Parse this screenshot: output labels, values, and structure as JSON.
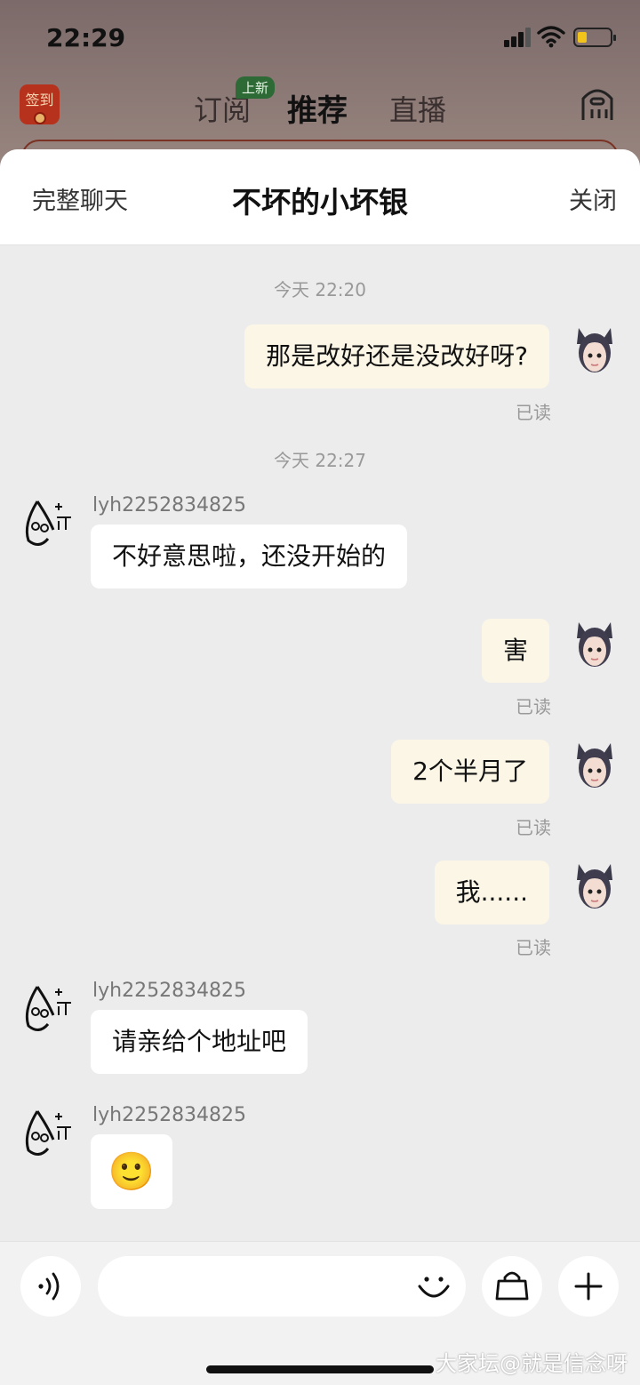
{
  "status_bar": {
    "time": "22:29",
    "battery_level": 0.3
  },
  "background_app": {
    "checkin_label": "签到",
    "tabs": [
      {
        "label": "订阅"
      },
      {
        "label": "推荐"
      },
      {
        "label": "直播"
      }
    ],
    "new_badge": "上新"
  },
  "chat_header": {
    "left_action": "完整聊天",
    "title": "不坏的小坏银",
    "right_action": "关闭"
  },
  "timestamps": [
    "今天 22:20",
    "今天 22:27"
  ],
  "messages": [
    {
      "from": "me",
      "text": "那是改好还是没改好呀?",
      "status": "已读"
    },
    {
      "from": "other",
      "sender": "lyh2252834825",
      "text": "不好意思啦，还没开始的"
    },
    {
      "from": "me",
      "text": "害",
      "status": "已读"
    },
    {
      "from": "me",
      "text": "2个半月了",
      "status": "已读"
    },
    {
      "from": "me",
      "text": "我......",
      "status": "已读"
    },
    {
      "from": "other",
      "sender": "lyh2252834825",
      "text": "请亲给个地址吧"
    },
    {
      "from": "other",
      "sender": "lyh2252834825",
      "text": "🙂"
    }
  ],
  "input_bar": {
    "voice_icon": "voice-icon",
    "emoji_icon": "emoji-icon",
    "shop_icon": "shopping-bag-icon",
    "plus_icon": "plus-icon"
  },
  "watermark": "大家坛@就是信念呀"
}
